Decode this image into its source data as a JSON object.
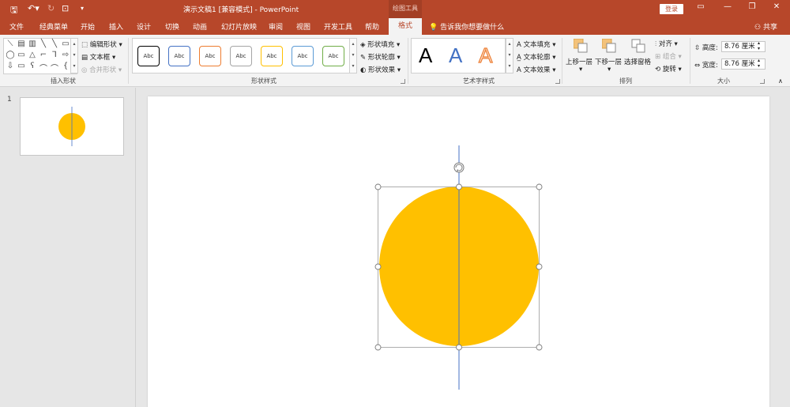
{
  "titlebar": {
    "title": "演示文稿1 [兼容模式]  -  PowerPoint",
    "context_tab_group": "绘图工具",
    "login_label": "登录"
  },
  "tabs": [
    "文件",
    "经典菜单",
    "开始",
    "插入",
    "设计",
    "切换",
    "动画",
    "幻灯片放映",
    "审阅",
    "视图",
    "开发工具",
    "帮助"
  ],
  "active_tab": "格式",
  "tell_me": "告诉我你想要做什么",
  "share_label": "共享",
  "ribbon": {
    "insert_shapes": {
      "label": "插入形状",
      "edit_shape": "编辑形状",
      "text_box": "文本框",
      "merge_shapes": "合并形状"
    },
    "shape_styles": {
      "label": "形状样式",
      "swatch_text": "Abc",
      "swatch_colors": [
        "#000000",
        "#4472c4",
        "#ed7d31",
        "#a5a5a5",
        "#ffc000",
        "#5b9bd5",
        "#70ad47"
      ],
      "fill": "形状填充",
      "outline": "形状轮廓",
      "effects": "形状效果"
    },
    "wordart": {
      "label": "艺术字样式",
      "letter": "A",
      "text_fill": "文本填充",
      "text_outline": "文本轮廓",
      "text_effects": "文本效果"
    },
    "arrange": {
      "label": "排列",
      "bring_forward": "上移一层",
      "send_backward": "下移一层",
      "selection_pane": "选择窗格",
      "align": "对齐",
      "group": "组合",
      "rotate": "旋转"
    },
    "size": {
      "label": "大小",
      "height_label": "高度:",
      "height_value": "8.76 厘米",
      "width_label": "宽度:",
      "width_value": "8.76 厘米"
    }
  },
  "slide_panel": {
    "slide_number": "1"
  },
  "colors": {
    "accent": "#b7472a",
    "circle_fill": "#ffc000",
    "guide_line": "#4472c4"
  }
}
